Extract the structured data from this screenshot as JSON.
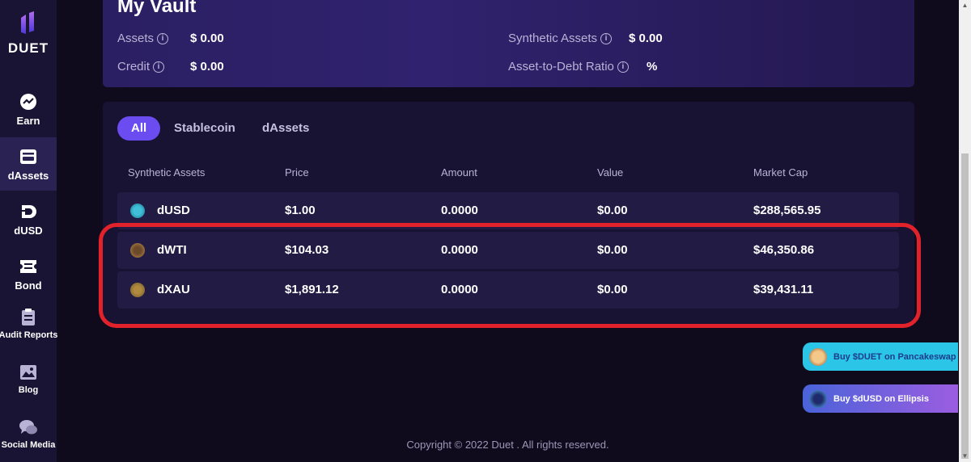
{
  "brand": {
    "name": "DUET"
  },
  "sidebar": {
    "items": [
      {
        "label": "Earn",
        "icon": "earn-icon"
      },
      {
        "label": "dAssets",
        "icon": "dassets-icon"
      },
      {
        "label": "dUSD",
        "icon": "dusd-icon"
      },
      {
        "label": "Bond",
        "icon": "bond-icon"
      },
      {
        "label": "Audit Reports",
        "icon": "audit-report-icon"
      },
      {
        "label": "Blog",
        "icon": "blog-icon"
      },
      {
        "label": "Social Media",
        "icon": "social-media-icon"
      }
    ],
    "active": "dAssets"
  },
  "vault": {
    "title": "My Vault",
    "assets_label": "Assets",
    "assets_value": "$ 0.00",
    "credit_label": "Credit",
    "credit_value": "$ 0.00",
    "synthetic_label": "Synthetic Assets",
    "synthetic_value": "$ 0.00",
    "ratio_label": "Asset-to-Debt Ratio",
    "ratio_value": "%"
  },
  "filter_tabs": [
    "All",
    "Stablecoin",
    "dAssets"
  ],
  "table": {
    "headers": [
      "Synthetic Assets",
      "Price",
      "Amount",
      "Value",
      "Market Cap"
    ],
    "rows": [
      {
        "name": "dUSD",
        "price": "$1.00",
        "amount": "0.0000",
        "value": "$0.00",
        "market_cap": "$288,565.95"
      },
      {
        "name": "dWTI",
        "price": "$104.03",
        "amount": "0.0000",
        "value": "$0.00",
        "market_cap": "$46,350.86"
      },
      {
        "name": "dXAU",
        "price": "$1,891.12",
        "amount": "0.0000",
        "value": "$0.00",
        "market_cap": "$39,431.11"
      }
    ]
  },
  "buy_buttons": {
    "duet": "Buy $DUET on Pancakeswap",
    "dusd": "Buy $dUSD on Ellipsis"
  },
  "footer": "Copyright © 2022 Duet . All rights reserved.",
  "colors": {
    "accent": "#6a4cf0",
    "highlight": "#e2222a",
    "pancake": "#2bc5e8"
  }
}
